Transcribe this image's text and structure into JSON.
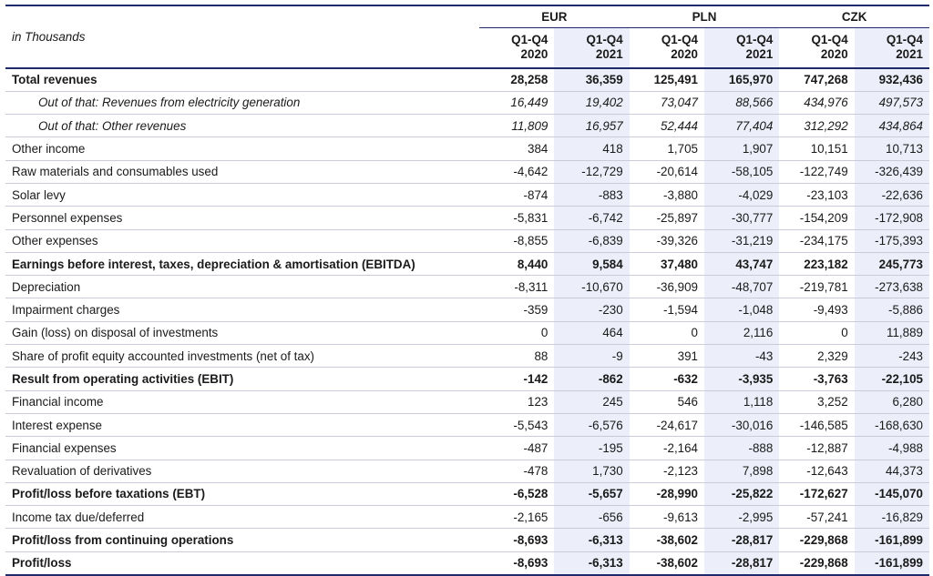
{
  "header": {
    "unit_label": "in Thousands",
    "currencies": [
      "EUR",
      "PLN",
      "CZK"
    ],
    "periods": [
      {
        "l1": "Q1-Q4",
        "l2": "2020"
      },
      {
        "l1": "Q1-Q4",
        "l2": "2021"
      },
      {
        "l1": "Q1-Q4",
        "l2": "2020"
      },
      {
        "l1": "Q1-Q4",
        "l2": "2021"
      },
      {
        "l1": "Q1-Q4",
        "l2": "2020"
      },
      {
        "l1": "Q1-Q4",
        "l2": "2021"
      }
    ]
  },
  "rows": [
    {
      "label": "Total revenues",
      "style": "bold",
      "values": [
        "28,258",
        "36,359",
        "125,491",
        "165,970",
        "747,268",
        "932,436"
      ]
    },
    {
      "label": "Out of that: Revenues from electricity generation",
      "style": "italic",
      "values": [
        "16,449",
        "19,402",
        "73,047",
        "88,566",
        "434,976",
        "497,573"
      ]
    },
    {
      "label": "Out of that: Other revenues",
      "style": "italic",
      "values": [
        "11,809",
        "16,957",
        "52,444",
        "77,404",
        "312,292",
        "434,864"
      ]
    },
    {
      "label": "Other income",
      "style": "normal",
      "values": [
        "384",
        "418",
        "1,705",
        "1,907",
        "10,151",
        "10,713"
      ]
    },
    {
      "label": "Raw materials and consumables used",
      "style": "normal",
      "values": [
        "-4,642",
        "-12,729",
        "-20,614",
        "-58,105",
        "-122,749",
        "-326,439"
      ]
    },
    {
      "label": "Solar levy",
      "style": "normal",
      "values": [
        "-874",
        "-883",
        "-3,880",
        "-4,029",
        "-23,103",
        "-22,636"
      ]
    },
    {
      "label": "Personnel expenses",
      "style": "normal",
      "values": [
        "-5,831",
        "-6,742",
        "-25,897",
        "-30,777",
        "-154,209",
        "-172,908"
      ]
    },
    {
      "label": "Other expenses",
      "style": "normal",
      "values": [
        "-8,855",
        "-6,839",
        "-39,326",
        "-31,219",
        "-234,175",
        "-175,393"
      ]
    },
    {
      "label": "Earnings before interest, taxes, depreciation & amortisation (EBITDA)",
      "style": "bold",
      "values": [
        "8,440",
        "9,584",
        "37,480",
        "43,747",
        "223,182",
        "245,773"
      ]
    },
    {
      "label": "Depreciation",
      "style": "normal",
      "values": [
        "-8,311",
        "-10,670",
        "-36,909",
        "-48,707",
        "-219,781",
        "-273,638"
      ]
    },
    {
      "label": "Impairment charges",
      "style": "normal",
      "values": [
        "-359",
        "-230",
        "-1,594",
        "-1,048",
        "-9,493",
        "-5,886"
      ]
    },
    {
      "label": "Gain (loss) on disposal of investments",
      "style": "normal",
      "values": [
        "0",
        "464",
        "0",
        "2,116",
        "0",
        "11,889"
      ]
    },
    {
      "label": "Share of profit equity accounted investments (net of tax)",
      "style": "normal",
      "values": [
        "88",
        "-9",
        "391",
        "-43",
        "2,329",
        "-243"
      ]
    },
    {
      "label": "Result from operating activities (EBIT)",
      "style": "bold",
      "values": [
        "-142",
        "-862",
        "-632",
        "-3,935",
        "-3,763",
        "-22,105"
      ]
    },
    {
      "label": "Financial income",
      "style": "normal",
      "values": [
        "123",
        "245",
        "546",
        "1,118",
        "3,252",
        "6,280"
      ]
    },
    {
      "label": "Interest expense",
      "style": "normal",
      "values": [
        "-5,543",
        "-6,576",
        "-24,617",
        "-30,016",
        "-146,585",
        "-168,630"
      ]
    },
    {
      "label": "Financial expenses",
      "style": "normal",
      "values": [
        "-487",
        "-195",
        "-2,164",
        "-888",
        "-12,887",
        "-4,988"
      ]
    },
    {
      "label": "Revaluation of derivatives",
      "style": "normal",
      "values": [
        "-478",
        "1,730",
        "-2,123",
        "7,898",
        "-12,643",
        "44,373"
      ]
    },
    {
      "label": "Profit/loss before taxations (EBT)",
      "style": "bold",
      "values": [
        "-6,528",
        "-5,657",
        "-28,990",
        "-25,822",
        "-172,627",
        "-145,070"
      ]
    },
    {
      "label": "Income tax due/deferred",
      "style": "normal",
      "values": [
        "-2,165",
        "-656",
        "-9,613",
        "-2,995",
        "-57,241",
        "-16,829"
      ]
    },
    {
      "label": "Profit/loss from continuing operations",
      "style": "bold",
      "values": [
        "-8,693",
        "-6,313",
        "-38,602",
        "-28,817",
        "-229,868",
        "-161,899"
      ]
    },
    {
      "label": "Profit/loss",
      "style": "bold",
      "values": [
        "-8,693",
        "-6,313",
        "-38,602",
        "-28,817",
        "-229,868",
        "-161,899"
      ]
    }
  ]
}
